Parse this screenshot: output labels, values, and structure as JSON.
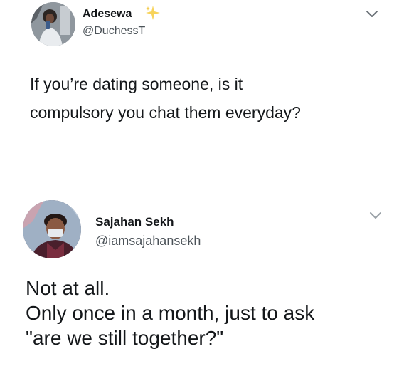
{
  "tweets": [
    {
      "author_name": "Adesewa",
      "author_handle": "@DuchessT_",
      "name_emoji": "sparkles-icon",
      "text_lines": [
        "If you’re dating someone, is it",
        "compulsory you chat them everyday?"
      ],
      "menu_icon": "chevron-down-icon"
    },
    {
      "author_name": "Sajahan Sekh",
      "author_handle": "@iamsajahansekh",
      "text_lines": [
        "Not at all.",
        "Only once in a month, just to ask",
        "\"are we still together?\""
      ],
      "menu_icon": "chevron-down-icon"
    }
  ],
  "colors": {
    "text": "#14171a",
    "handle": "#4b5258",
    "sparkle": "#f7d35a",
    "chevron": "#6b7278"
  }
}
